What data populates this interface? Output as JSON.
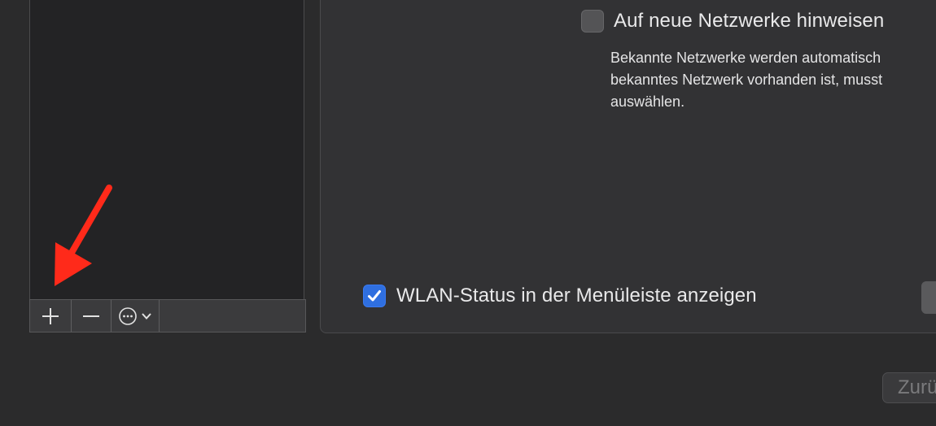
{
  "window": {
    "background_color": "#2b2b2c"
  },
  "service_list": {
    "toolbar": {
      "add_icon": "plus-icon",
      "remove_icon": "minus-icon",
      "action_icon": "ellipsis-circle-icon",
      "action_menu_icon": "chevron-down-icon"
    }
  },
  "details": {
    "ask_new_networks": {
      "label": "Auf neue Netzwerke hinweisen",
      "checked": false
    },
    "help_text": {
      "line1": "Bekannte Netzwerke werden automatisch",
      "line2": "bekanntes Netzwerk vorhanden ist, musst",
      "line3": "auswählen."
    },
    "show_wifi_status": {
      "label": "WLAN-Status in der Menüleiste anzeigen",
      "checked": true
    },
    "accent_color": "#2f6fe0"
  },
  "footer": {
    "back_button_label": "Zurü"
  },
  "annotation": {
    "arrow_color": "#ff2a1a",
    "arrow_icon": "red-arrow-annotation"
  }
}
